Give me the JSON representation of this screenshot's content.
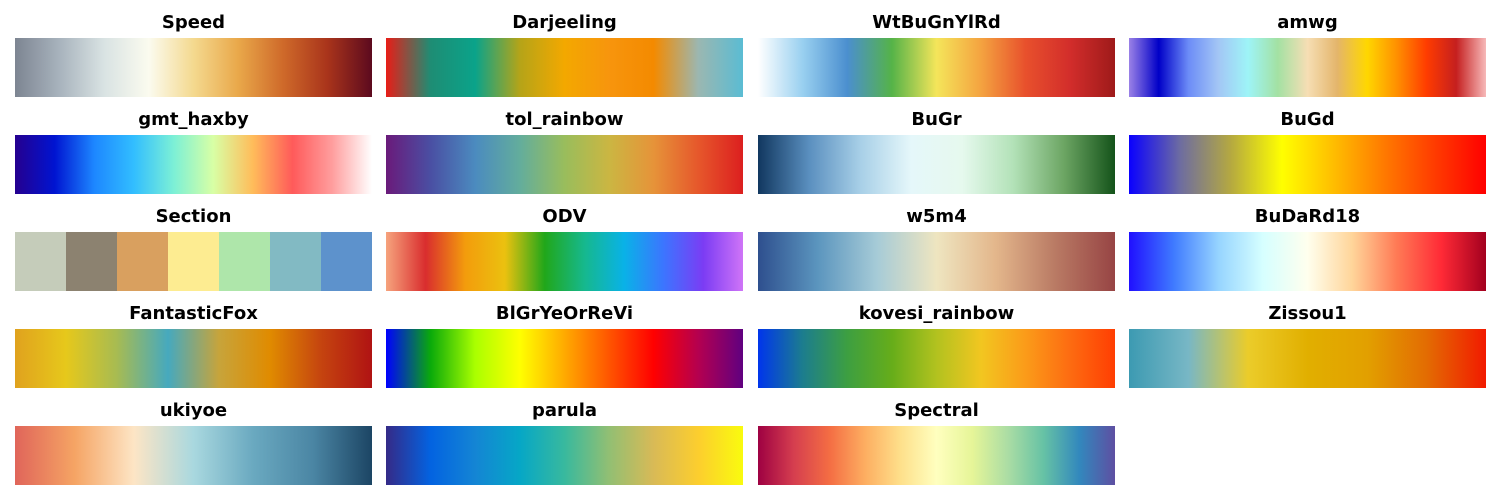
{
  "colormaps": [
    {
      "name": "Speed",
      "mode": "smooth",
      "colors": [
        "#7d8592",
        "#a8b3bd",
        "#d9e3e3",
        "#fbfbef",
        "#f4d98f",
        "#e9a84a",
        "#cf6a2a",
        "#a9341b",
        "#5c0a1e"
      ]
    },
    {
      "name": "Darjeeling",
      "mode": "smooth",
      "colors": [
        "#e81d17",
        "#1e8d74",
        "#0aa38a",
        "#b5a418",
        "#f3a800",
        "#f7950d",
        "#f48a00",
        "#9bb7b1",
        "#5abcd3"
      ]
    },
    {
      "name": "WtBuGnYlRd",
      "mode": "smooth",
      "colors": [
        "#ffffff",
        "#99d0f0",
        "#4b8fcf",
        "#55b348",
        "#f4e55a",
        "#f4a340",
        "#e8502c",
        "#d22d2b",
        "#9e1a1a"
      ]
    },
    {
      "name": "amwg",
      "mode": "smooth",
      "colors": [
        "#9a81e6",
        "#0000c8",
        "#6c8cf7",
        "#a3c6f5",
        "#9ef4f7",
        "#a3e1a3",
        "#f6deb4",
        "#e4b56b",
        "#ffd700",
        "#ff9000",
        "#ff3c00",
        "#c51f1f",
        "#f7b9b9"
      ]
    },
    {
      "name": "gmt_haxby",
      "mode": "smooth",
      "colors": [
        "#25008f",
        "#0014d1",
        "#1d87ff",
        "#32beff",
        "#7cf0d6",
        "#d8ffa5",
        "#ffbc5a",
        "#ff5a5a",
        "#ff9e9e",
        "#ffffff"
      ]
    },
    {
      "name": "tol_rainbow",
      "mode": "smooth",
      "colors": [
        "#6a1a7a",
        "#4a4fa3",
        "#4b8bbf",
        "#63ad9c",
        "#99bd5c",
        "#cbb642",
        "#e69339",
        "#e6572b",
        "#dc1f1f"
      ]
    },
    {
      "name": "BuGr",
      "mode": "smooth",
      "colors": [
        "#11375f",
        "#5a8fbf",
        "#a7cfe7",
        "#e5f7fa",
        "#e6f9ee",
        "#b3e2b8",
        "#6ca563",
        "#14531a"
      ]
    },
    {
      "name": "BuGd",
      "mode": "smooth",
      "colors": [
        "#0a00ff",
        "#6d6ca1",
        "#b5a940",
        "#ffff00",
        "#ffbe00",
        "#ff7a00",
        "#ff3b00",
        "#ff0000"
      ]
    },
    {
      "name": "Section",
      "mode": "discrete",
      "colors": [
        "#c5ccba",
        "#8c8270",
        "#d9a05f",
        "#fdec91",
        "#aee6aa",
        "#82bac3",
        "#5d92cc"
      ]
    },
    {
      "name": "ODV",
      "mode": "smooth",
      "colors": [
        "#f6a37d",
        "#d92d2e",
        "#f39c0c",
        "#ebc10f",
        "#21a71a",
        "#16b88d",
        "#09b2e7",
        "#3c75ff",
        "#7b3cf4",
        "#cf74f7"
      ]
    },
    {
      "name": "w5m4",
      "mode": "smooth",
      "colors": [
        "#2e4f8e",
        "#5b95be",
        "#a6cbd7",
        "#eee5c0",
        "#e3b68b",
        "#b97a64",
        "#974444"
      ]
    },
    {
      "name": "BuDaRd18",
      "mode": "smooth",
      "colors": [
        "#2010ff",
        "#3f7aff",
        "#96d4ff",
        "#d6ffff",
        "#ffffee",
        "#ffd59a",
        "#ff7a55",
        "#ff2a36",
        "#a3001f"
      ]
    },
    {
      "name": "FantasticFox",
      "mode": "smooth",
      "colors": [
        "#e0a21e",
        "#e6c81b",
        "#a7bb52",
        "#46a9be",
        "#c7a43b",
        "#e08b00",
        "#c5440f",
        "#b01313"
      ]
    },
    {
      "name": "BlGrYeOrReVi",
      "mode": "smooth",
      "colors": [
        "#0000ff",
        "#0aaa0a",
        "#aaff00",
        "#ffff00",
        "#ffaa00",
        "#ff5500",
        "#ff0000",
        "#b40050",
        "#600080"
      ]
    },
    {
      "name": "kovesi_rainbow",
      "mode": "smooth",
      "colors": [
        "#0035ec",
        "#1c7d8e",
        "#3d9f41",
        "#66ad1a",
        "#b2c21f",
        "#f2c620",
        "#fb9b19",
        "#fd6b11",
        "#ff3e02"
      ]
    },
    {
      "name": "Zissou1",
      "mode": "smooth",
      "colors": [
        "#3c9ab2",
        "#78b7c5",
        "#ebcc2a",
        "#e1af00",
        "#e2a000",
        "#e36c02",
        "#f21a00"
      ]
    },
    {
      "name": "ukiyoe",
      "mode": "smooth",
      "colors": [
        "#e0655a",
        "#f5a464",
        "#fde5c5",
        "#a9d8df",
        "#6aa9c0",
        "#4b86a4",
        "#1c4564"
      ]
    },
    {
      "name": "parula",
      "mode": "smooth",
      "colors": [
        "#352a87",
        "#0363e1",
        "#1485d4",
        "#06a7c6",
        "#38b99e",
        "#92bf73",
        "#d9ba56",
        "#fcce2e",
        "#f9fb0e"
      ]
    },
    {
      "name": "Spectral",
      "mode": "smooth",
      "colors": [
        "#9e0142",
        "#d53e4f",
        "#f46d43",
        "#fdae61",
        "#fee08b",
        "#ffffbf",
        "#e6f598",
        "#abdda4",
        "#66c2a5",
        "#3288bd",
        "#5e4fa2"
      ]
    }
  ]
}
